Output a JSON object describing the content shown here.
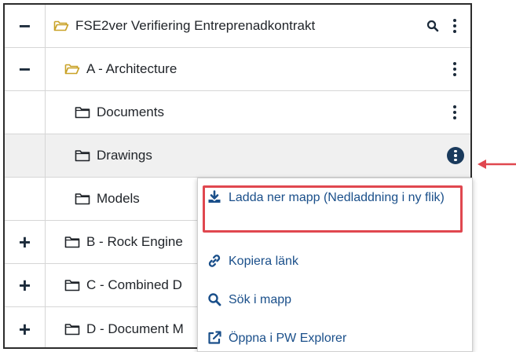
{
  "tree": {
    "rows": [
      {
        "toggle": "−",
        "label": "FSE2ver Verifiering Entreprenadkontrakt"
      },
      {
        "toggle": "−",
        "label": "A - Architecture"
      },
      {
        "toggle": "",
        "label": "Documents"
      },
      {
        "toggle": "",
        "label": "Drawings"
      },
      {
        "toggle": "",
        "label": "Models"
      },
      {
        "toggle": "+",
        "label": "B - Rock Engine"
      },
      {
        "toggle": "+",
        "label": "C - Combined D"
      },
      {
        "toggle": "+",
        "label": "D - Document M"
      }
    ]
  },
  "context_menu": {
    "items": [
      {
        "label": "Ladda ner mapp (Nedladdning i ny flik)",
        "icon": "download-icon"
      },
      {
        "label": "Kopiera länk",
        "icon": "link-icon"
      },
      {
        "label": "Sök i mapp",
        "icon": "search-icon"
      },
      {
        "label": "Öppna i PW Explorer",
        "icon": "external-link-icon"
      }
    ]
  },
  "colors": {
    "folder_yellow": "#c9a227",
    "menu_text": "#1a4f8a",
    "highlight_red": "#e0474f",
    "kebab_dark": "#1a3a5c"
  }
}
